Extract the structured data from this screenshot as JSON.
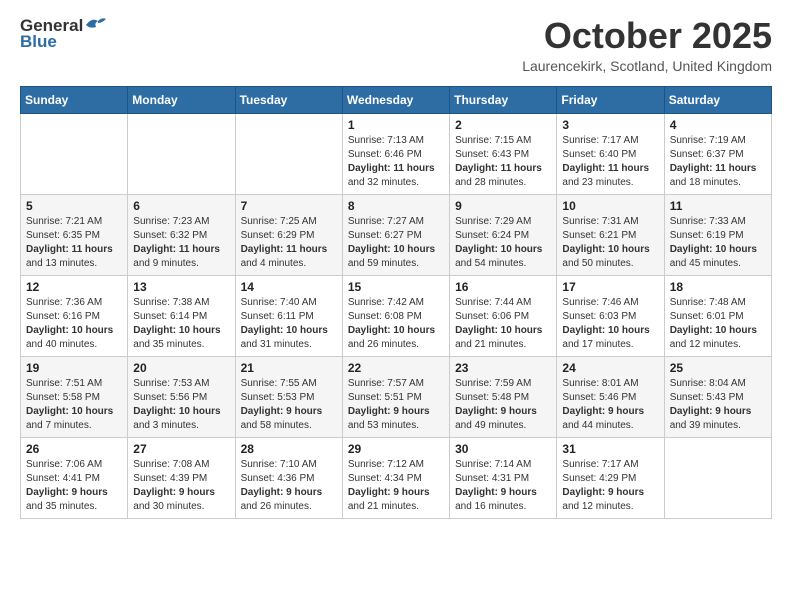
{
  "header": {
    "logo_general": "General",
    "logo_blue": "Blue",
    "month_title": "October 2025",
    "location": "Laurencekirk, Scotland, United Kingdom"
  },
  "days_of_week": [
    "Sunday",
    "Monday",
    "Tuesday",
    "Wednesday",
    "Thursday",
    "Friday",
    "Saturday"
  ],
  "weeks": [
    [
      {
        "day": "",
        "info": ""
      },
      {
        "day": "",
        "info": ""
      },
      {
        "day": "",
        "info": ""
      },
      {
        "day": "1",
        "info": "Sunrise: 7:13 AM\nSunset: 6:46 PM\nDaylight: 11 hours\nand 32 minutes."
      },
      {
        "day": "2",
        "info": "Sunrise: 7:15 AM\nSunset: 6:43 PM\nDaylight: 11 hours\nand 28 minutes."
      },
      {
        "day": "3",
        "info": "Sunrise: 7:17 AM\nSunset: 6:40 PM\nDaylight: 11 hours\nand 23 minutes."
      },
      {
        "day": "4",
        "info": "Sunrise: 7:19 AM\nSunset: 6:37 PM\nDaylight: 11 hours\nand 18 minutes."
      }
    ],
    [
      {
        "day": "5",
        "info": "Sunrise: 7:21 AM\nSunset: 6:35 PM\nDaylight: 11 hours\nand 13 minutes."
      },
      {
        "day": "6",
        "info": "Sunrise: 7:23 AM\nSunset: 6:32 PM\nDaylight: 11 hours\nand 9 minutes."
      },
      {
        "day": "7",
        "info": "Sunrise: 7:25 AM\nSunset: 6:29 PM\nDaylight: 11 hours\nand 4 minutes."
      },
      {
        "day": "8",
        "info": "Sunrise: 7:27 AM\nSunset: 6:27 PM\nDaylight: 10 hours\nand 59 minutes."
      },
      {
        "day": "9",
        "info": "Sunrise: 7:29 AM\nSunset: 6:24 PM\nDaylight: 10 hours\nand 54 minutes."
      },
      {
        "day": "10",
        "info": "Sunrise: 7:31 AM\nSunset: 6:21 PM\nDaylight: 10 hours\nand 50 minutes."
      },
      {
        "day": "11",
        "info": "Sunrise: 7:33 AM\nSunset: 6:19 PM\nDaylight: 10 hours\nand 45 minutes."
      }
    ],
    [
      {
        "day": "12",
        "info": "Sunrise: 7:36 AM\nSunset: 6:16 PM\nDaylight: 10 hours\nand 40 minutes."
      },
      {
        "day": "13",
        "info": "Sunrise: 7:38 AM\nSunset: 6:14 PM\nDaylight: 10 hours\nand 35 minutes."
      },
      {
        "day": "14",
        "info": "Sunrise: 7:40 AM\nSunset: 6:11 PM\nDaylight: 10 hours\nand 31 minutes."
      },
      {
        "day": "15",
        "info": "Sunrise: 7:42 AM\nSunset: 6:08 PM\nDaylight: 10 hours\nand 26 minutes."
      },
      {
        "day": "16",
        "info": "Sunrise: 7:44 AM\nSunset: 6:06 PM\nDaylight: 10 hours\nand 21 minutes."
      },
      {
        "day": "17",
        "info": "Sunrise: 7:46 AM\nSunset: 6:03 PM\nDaylight: 10 hours\nand 17 minutes."
      },
      {
        "day": "18",
        "info": "Sunrise: 7:48 AM\nSunset: 6:01 PM\nDaylight: 10 hours\nand 12 minutes."
      }
    ],
    [
      {
        "day": "19",
        "info": "Sunrise: 7:51 AM\nSunset: 5:58 PM\nDaylight: 10 hours\nand 7 minutes."
      },
      {
        "day": "20",
        "info": "Sunrise: 7:53 AM\nSunset: 5:56 PM\nDaylight: 10 hours\nand 3 minutes."
      },
      {
        "day": "21",
        "info": "Sunrise: 7:55 AM\nSunset: 5:53 PM\nDaylight: 9 hours\nand 58 minutes."
      },
      {
        "day": "22",
        "info": "Sunrise: 7:57 AM\nSunset: 5:51 PM\nDaylight: 9 hours\nand 53 minutes."
      },
      {
        "day": "23",
        "info": "Sunrise: 7:59 AM\nSunset: 5:48 PM\nDaylight: 9 hours\nand 49 minutes."
      },
      {
        "day": "24",
        "info": "Sunrise: 8:01 AM\nSunset: 5:46 PM\nDaylight: 9 hours\nand 44 minutes."
      },
      {
        "day": "25",
        "info": "Sunrise: 8:04 AM\nSunset: 5:43 PM\nDaylight: 9 hours\nand 39 minutes."
      }
    ],
    [
      {
        "day": "26",
        "info": "Sunrise: 7:06 AM\nSunset: 4:41 PM\nDaylight: 9 hours\nand 35 minutes."
      },
      {
        "day": "27",
        "info": "Sunrise: 7:08 AM\nSunset: 4:39 PM\nDaylight: 9 hours\nand 30 minutes."
      },
      {
        "day": "28",
        "info": "Sunrise: 7:10 AM\nSunset: 4:36 PM\nDaylight: 9 hours\nand 26 minutes."
      },
      {
        "day": "29",
        "info": "Sunrise: 7:12 AM\nSunset: 4:34 PM\nDaylight: 9 hours\nand 21 minutes."
      },
      {
        "day": "30",
        "info": "Sunrise: 7:14 AM\nSunset: 4:31 PM\nDaylight: 9 hours\nand 16 minutes."
      },
      {
        "day": "31",
        "info": "Sunrise: 7:17 AM\nSunset: 4:29 PM\nDaylight: 9 hours\nand 12 minutes."
      },
      {
        "day": "",
        "info": ""
      }
    ]
  ]
}
